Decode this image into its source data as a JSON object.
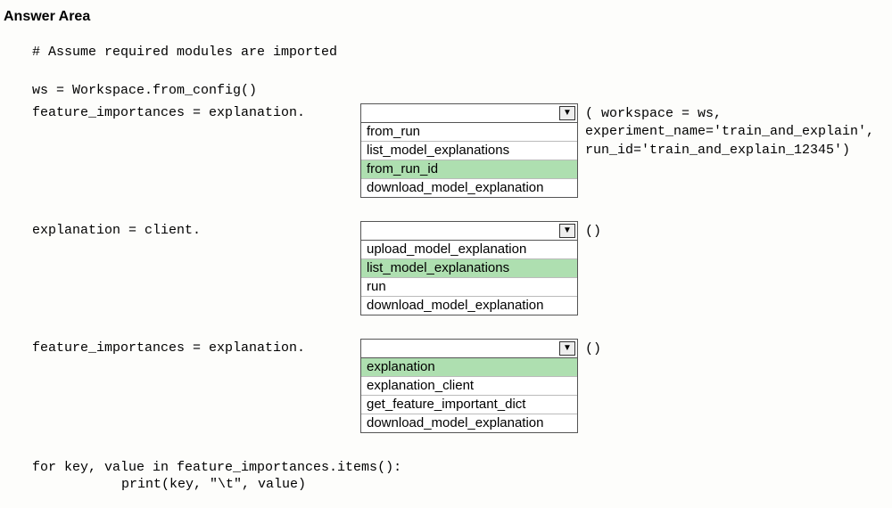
{
  "header": {
    "title": "Answer Area"
  },
  "code": {
    "comment": "# Assume required modules are imported",
    "ws_line": "ws = Workspace.from_config()",
    "feat_imp_expl": "feature_importances = explanation.",
    "expl_client": "explanation = client.",
    "footer1": "for key, value in feature_importances.items():",
    "footer2": "print(key, \"\\t\", value)"
  },
  "dropdowns": [
    {
      "right_text": "( workspace = ws,\nexperiment_name='train_and_explain',\nrun_id='train_and_explain_12345')",
      "options": [
        {
          "label": "from_run",
          "highlighted": false
        },
        {
          "label": "list_model_explanations",
          "highlighted": false
        },
        {
          "label": "from_run_id",
          "highlighted": true
        },
        {
          "label": "download_model_explanation",
          "highlighted": false
        }
      ]
    },
    {
      "right_text": "()",
      "options": [
        {
          "label": "upload_model_explanation",
          "highlighted": false
        },
        {
          "label": "list_model_explanations",
          "highlighted": true
        },
        {
          "label": "run",
          "highlighted": false
        },
        {
          "label": "download_model_explanation",
          "highlighted": false
        }
      ]
    },
    {
      "right_text": "()",
      "options": [
        {
          "label": "explanation",
          "highlighted": true
        },
        {
          "label": "explanation_client",
          "highlighted": false
        },
        {
          "label": "get_feature_important_dict",
          "highlighted": false
        },
        {
          "label": "download_model_explanation",
          "highlighted": false
        }
      ]
    }
  ]
}
